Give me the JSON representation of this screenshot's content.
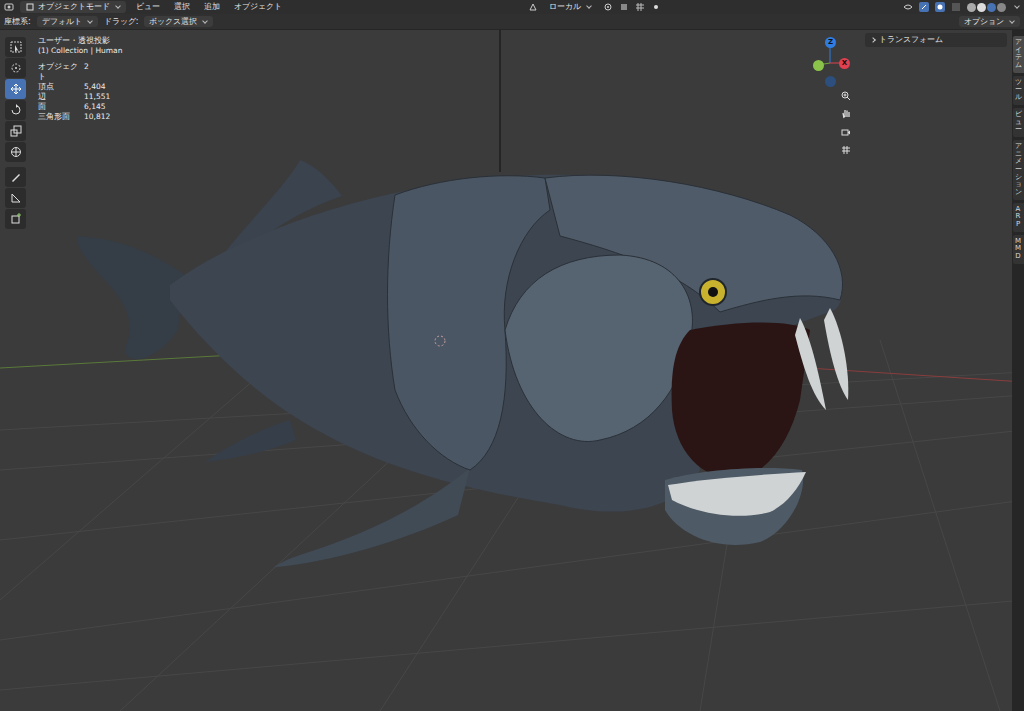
{
  "header": {
    "mode": "オブジェクトモード",
    "menus": [
      "ビュー",
      "選択",
      "追加",
      "オブジェクト"
    ],
    "orientation": "ローカル",
    "options": "オプション"
  },
  "tool_settings": {
    "orientation_label": "座標系:",
    "orientation": "デフォルト",
    "drag_label": "ドラッグ:",
    "drag": "ボックス選択"
  },
  "viewport": {
    "view_name": "ユーザー・透視投影",
    "collection": "(1) Collection | Human",
    "stats": [
      {
        "label": "オブジェクト",
        "value": "2"
      },
      {
        "label": "頂点",
        "value": "5,404"
      },
      {
        "label": "辺",
        "value": "11,551"
      },
      {
        "label": "面",
        "value": "6,145"
      },
      {
        "label": "三角形面",
        "value": "10,812"
      }
    ]
  },
  "toolbar": [
    {
      "kind": "select",
      "selected": false
    },
    {
      "kind": "cursor",
      "selected": false
    },
    {
      "kind": "move",
      "selected": true
    },
    {
      "kind": "rotate",
      "selected": false
    },
    {
      "kind": "scale",
      "selected": false
    },
    {
      "kind": "transform",
      "selected": false
    },
    {
      "kind": "annotate",
      "selected": false
    },
    {
      "kind": "measure",
      "selected": false
    },
    {
      "kind": "addcube",
      "selected": false
    }
  ],
  "gizmo": {
    "axes": [
      {
        "label": "Z",
        "color": "#2f7de1"
      },
      {
        "label": "X",
        "color": "#e0404f"
      }
    ]
  },
  "sidebar": {
    "tabs": [
      {
        "label": "アイテム",
        "selected": true
      },
      {
        "label": "ツール",
        "selected": false
      },
      {
        "label": "ビュー",
        "selected": false
      },
      {
        "label": "アニメーション",
        "selected": false
      },
      {
        "label": "ARP",
        "selected": false
      },
      {
        "label": "MMD",
        "selected": false
      }
    ],
    "panels": [
      {
        "label": "トランスフォーム",
        "expanded": false
      }
    ]
  }
}
